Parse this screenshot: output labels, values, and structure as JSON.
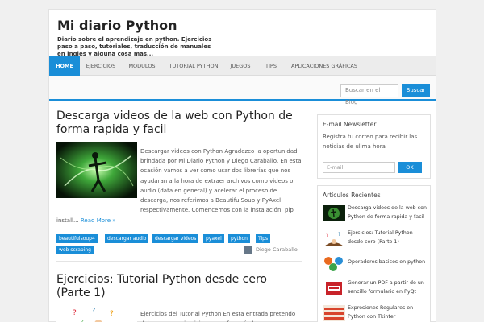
{
  "site": {
    "title": "Mi diario Python",
    "description": "Diario sobre el aprendizaje en python. Ejercicios paso a paso, tutoriales, traducción de manuales en ingles y alguna cosa mas..."
  },
  "nav": {
    "items": [
      {
        "label": "HOME",
        "active": true
      },
      {
        "label": "EJERCICIOS"
      },
      {
        "label": "MODULOS"
      },
      {
        "label": "TUTORIAL PYTHON"
      },
      {
        "label": "JUEGOS"
      },
      {
        "label": "TIPS"
      },
      {
        "label": "APLICACIONES GRÁFICAS"
      }
    ]
  },
  "search": {
    "placeholder": "Buscar en el Blog",
    "button": "Buscar"
  },
  "posts": [
    {
      "title": "Descarga videos de la web con Python de forma rapida y facil",
      "excerpt": "Descargar videos con Python Agradezco la oportunidad brindada por Mi Diario Python y Diego Caraballo. En esta ocasión vamos a ver como usar dos librerías que nos ayudaran a la hora de extraer archivos como videos o audio (data en general) y acelerar el proceso de descarga, nos referimos a BeautifulSoup y PyAxel respectivamente. Comencemos con la instalación: pip",
      "excerpt_end": "install...",
      "read_more": "Read More »",
      "tags": [
        "beautifulsoup4",
        "descargar audio",
        "descargar videos",
        "pyaxel",
        "python",
        "Tips",
        "web scraping"
      ],
      "author": "Diego Caraballo"
    },
    {
      "title": "Ejercicios: Tutorial Python desde cero (Parte 1)",
      "excerpt": "Ejercicios del Tutorial Python En esta entrada pretendo dejar algunos ejercicios que reforzarán los"
    }
  ],
  "sidebar": {
    "newsletter": {
      "title": "E-mail Newsletter",
      "text": "Registra tu correo para recibir las noticias de ulima hora",
      "placeholder": "E-mail",
      "button": "OK"
    },
    "recent": {
      "title": "Artículos Recientes",
      "items": [
        "Descarga videos de la web con Python de forma rapida y facil",
        "Ejercicios: Tutorial Python desde cero (Parte 1)",
        "Operadores basicos en python",
        "Generar un PDF a partir de un sencillo formulario en PyQt",
        "Expresiones Regulares en Python con Tkinter"
      ]
    }
  },
  "colors": {
    "accent": "#1a8ed8",
    "background": "#f0f0f0"
  }
}
